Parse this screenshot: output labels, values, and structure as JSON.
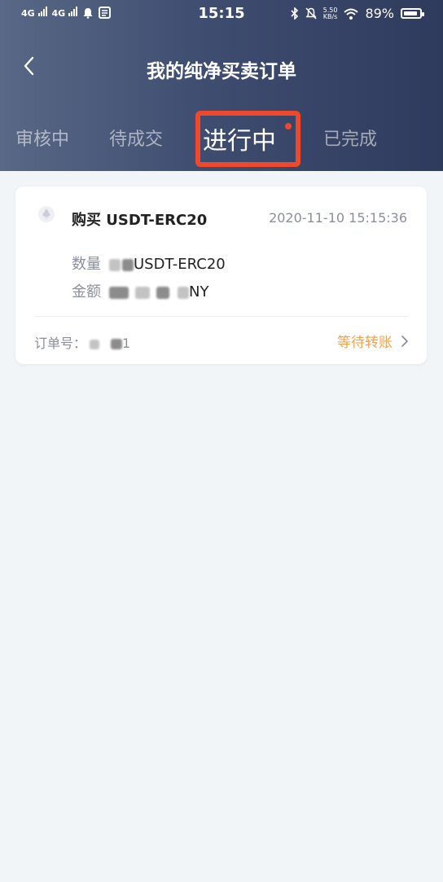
{
  "status_bar": {
    "left_labels": [
      "4G",
      "4G"
    ],
    "time": "15:15",
    "net_speed": "5.50\nKB/s",
    "battery": "89%",
    "battery_level": 0.89
  },
  "header": {
    "title": "我的纯净买卖订单"
  },
  "tabs": [
    {
      "label": "审核中"
    },
    {
      "label": "待成交"
    },
    {
      "label": "进行中"
    },
    {
      "label": "已完成"
    }
  ],
  "active_tab": "进行中",
  "order": {
    "title": "购买 USDT-ERC20",
    "datetime": "2020-11-10 15:15:36",
    "quantity_label": "数量",
    "quantity_suffix": "USDT-ERC20",
    "amount_label": "金额",
    "amount_suffix": "NY",
    "order_no_label": "订单号：",
    "order_no_suffix": "1",
    "status": "等待转账"
  },
  "colors": {
    "accent": "#f0a34d",
    "highlight": "#f0482a",
    "header_start": "#5a6887",
    "header_end": "#2f3b5d"
  }
}
